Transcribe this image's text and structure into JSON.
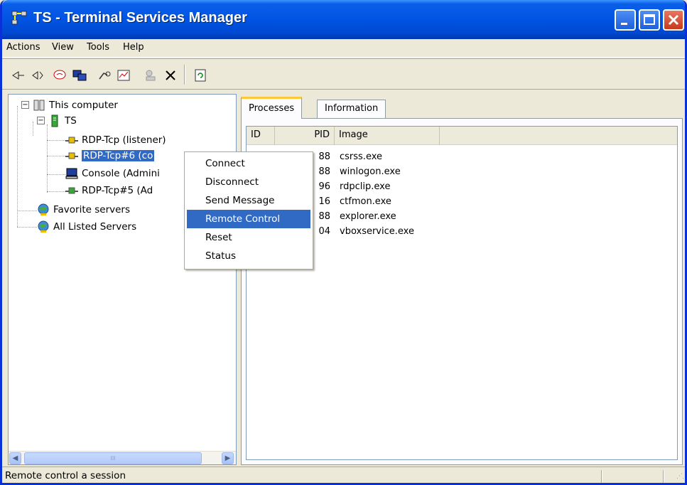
{
  "window": {
    "title": "TS - Terminal Services Manager"
  },
  "menu": [
    {
      "label": "Actions"
    },
    {
      "label": "View"
    },
    {
      "label": "Tools"
    },
    {
      "label": "Help"
    }
  ],
  "toolbar": {
    "icons": [
      "connect-icon",
      "disconnect-icon",
      "send-message-icon",
      "remote-control-icon",
      "reset-icon",
      "status-icon",
      "logoff-icon",
      "end-process-icon",
      "refresh-icon"
    ]
  },
  "tree": {
    "root": "This computer",
    "server": "TS",
    "sessions": [
      "RDP-Tcp (listener)",
      "RDP-Tcp#6 (co",
      "Console (Admini",
      "RDP-Tcp#5 (Ad"
    ],
    "favorites": "Favorite servers",
    "all_listed": "All Listed Servers"
  },
  "tabs": [
    {
      "label": "Processes"
    },
    {
      "label": "Information"
    }
  ],
  "processes": {
    "columns": [
      "ID",
      "PID",
      "Image"
    ],
    "rows": [
      {
        "id": "",
        "pid": "88",
        "image": "csrss.exe"
      },
      {
        "id": "",
        "pid": "88",
        "image": "winlogon.exe"
      },
      {
        "id": "",
        "pid": "96",
        "image": "rdpclip.exe"
      },
      {
        "id": "",
        "pid": "16",
        "image": "ctfmon.exe"
      },
      {
        "id": "",
        "pid": "88",
        "image": "explorer.exe"
      },
      {
        "id": "",
        "pid": "04",
        "image": "vboxservice.exe"
      }
    ]
  },
  "context_menu": {
    "items": [
      "Connect",
      "Disconnect",
      "Send Message",
      "Remote Control",
      "Reset",
      "Status"
    ],
    "highlighted": "Remote Control"
  },
  "status": {
    "text": "Remote control a session"
  },
  "scrollbar": {
    "thumb_grip": "III"
  },
  "colors": {
    "title_bar": "#0054e3",
    "selection": "#316ac5",
    "active_tab_accent": "#ffc83c"
  }
}
